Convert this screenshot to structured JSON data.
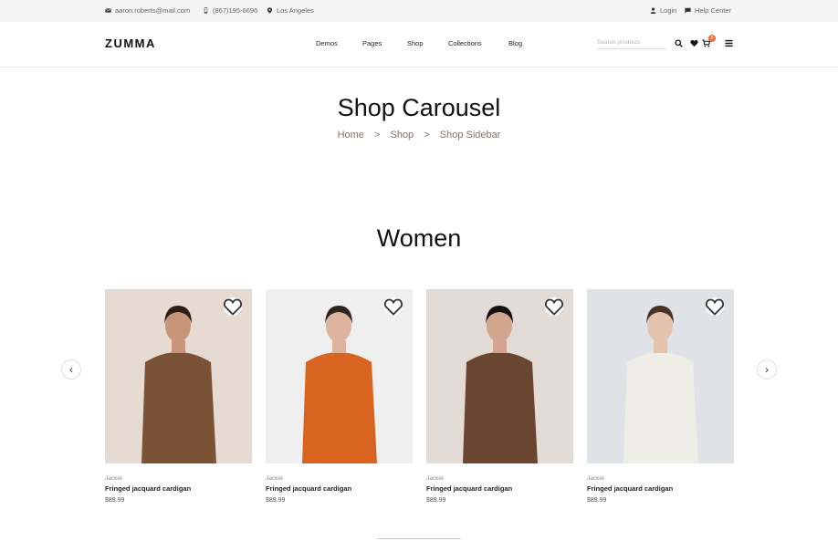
{
  "topbar": {
    "email": "aaron.roberts@mail.com",
    "phone": "(867)195-6696",
    "location": "Los Angeles",
    "login": "Login",
    "help": "Help Center"
  },
  "header": {
    "logo": "ZUMMA",
    "nav": [
      "Demos",
      "Pages",
      "Shop",
      "Collections",
      "Blog"
    ],
    "search_placeholder": "Search products",
    "cart_count": "0"
  },
  "hero": {
    "title": "Shop Carousel",
    "breadcrumb": [
      "Home",
      "Shop",
      "Shop Sidebar"
    ],
    "separator": ">"
  },
  "section": {
    "title": "Women",
    "prev_label": "‹",
    "next_label": "›"
  },
  "products": [
    {
      "category": "Jacket",
      "name": "Fringed jacquard cardigan",
      "price": "$89.99",
      "bg": "#e6dbd2",
      "garment": "#7a5236",
      "skin": "#c9957a",
      "hair": "#2a1d16",
      "bottom": "#6b4a33"
    },
    {
      "category": "Jacket",
      "name": "Fringed jacquard cardigan",
      "price": "$89.99",
      "bg": "#efefef",
      "garment": "#d9641f",
      "skin": "#dcb39c",
      "hair": "#2e241f",
      "bottom": "#cf5d1d"
    },
    {
      "category": "Jacket",
      "name": "Fringed jacquard cardigan",
      "price": "$89.99",
      "bg": "#e3dcd6",
      "garment": "#6a4630",
      "skin": "#d2a58f",
      "hair": "#141010",
      "bottom": "#5b3b28"
    },
    {
      "category": "Jacket",
      "name": "Fringed jacquard cardigan",
      "price": "$89.99",
      "bg": "#dfe2e6",
      "garment": "#eeeee6",
      "skin": "#e3c3ae",
      "hair": "#4a3224",
      "bottom": "#5d7aa6"
    }
  ]
}
